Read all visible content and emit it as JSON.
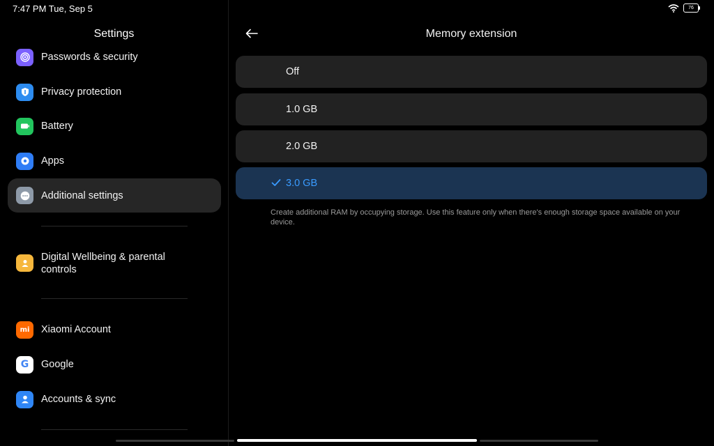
{
  "status": {
    "time": "7:47 PM Tue, Sep 5",
    "battery": "76"
  },
  "left": {
    "title": "Settings",
    "items": [
      {
        "label": "Passwords & security",
        "icon": "fingerprint-icon",
        "color": "#7b61ff"
      },
      {
        "label": "Privacy protection",
        "icon": "privacy-icon",
        "color": "#2d8cf0"
      },
      {
        "label": "Battery",
        "icon": "battery-icon",
        "color": "#22c55e"
      },
      {
        "label": "Apps",
        "icon": "gear-icon",
        "color": "#2f7df6"
      },
      {
        "label": "Additional settings",
        "icon": "more-icon",
        "color": "#8e9aa8"
      },
      {
        "label": "Digital Wellbeing & parental controls",
        "icon": "wellbeing-icon",
        "color": "#f6b73c"
      },
      {
        "label": "Xiaomi Account",
        "icon": "mi-icon",
        "color": "#ff6900"
      },
      {
        "label": "Google",
        "icon": "google-icon",
        "color": "#ffffff"
      },
      {
        "label": "Accounts & sync",
        "icon": "person-icon",
        "color": "#2f86f6"
      }
    ]
  },
  "right": {
    "title": "Memory extension",
    "options": [
      {
        "label": "Off",
        "selected": false
      },
      {
        "label": "1.0 GB",
        "selected": false
      },
      {
        "label": "2.0 GB",
        "selected": false
      },
      {
        "label": "3.0 GB",
        "selected": true
      }
    ],
    "description": "Create additional RAM by occupying storage. Use this feature only when there's enough storage space available on your device."
  },
  "colors": {
    "accent": "#3a9bff",
    "selected_bg": "#1b3452",
    "row_bg": "#222222"
  }
}
